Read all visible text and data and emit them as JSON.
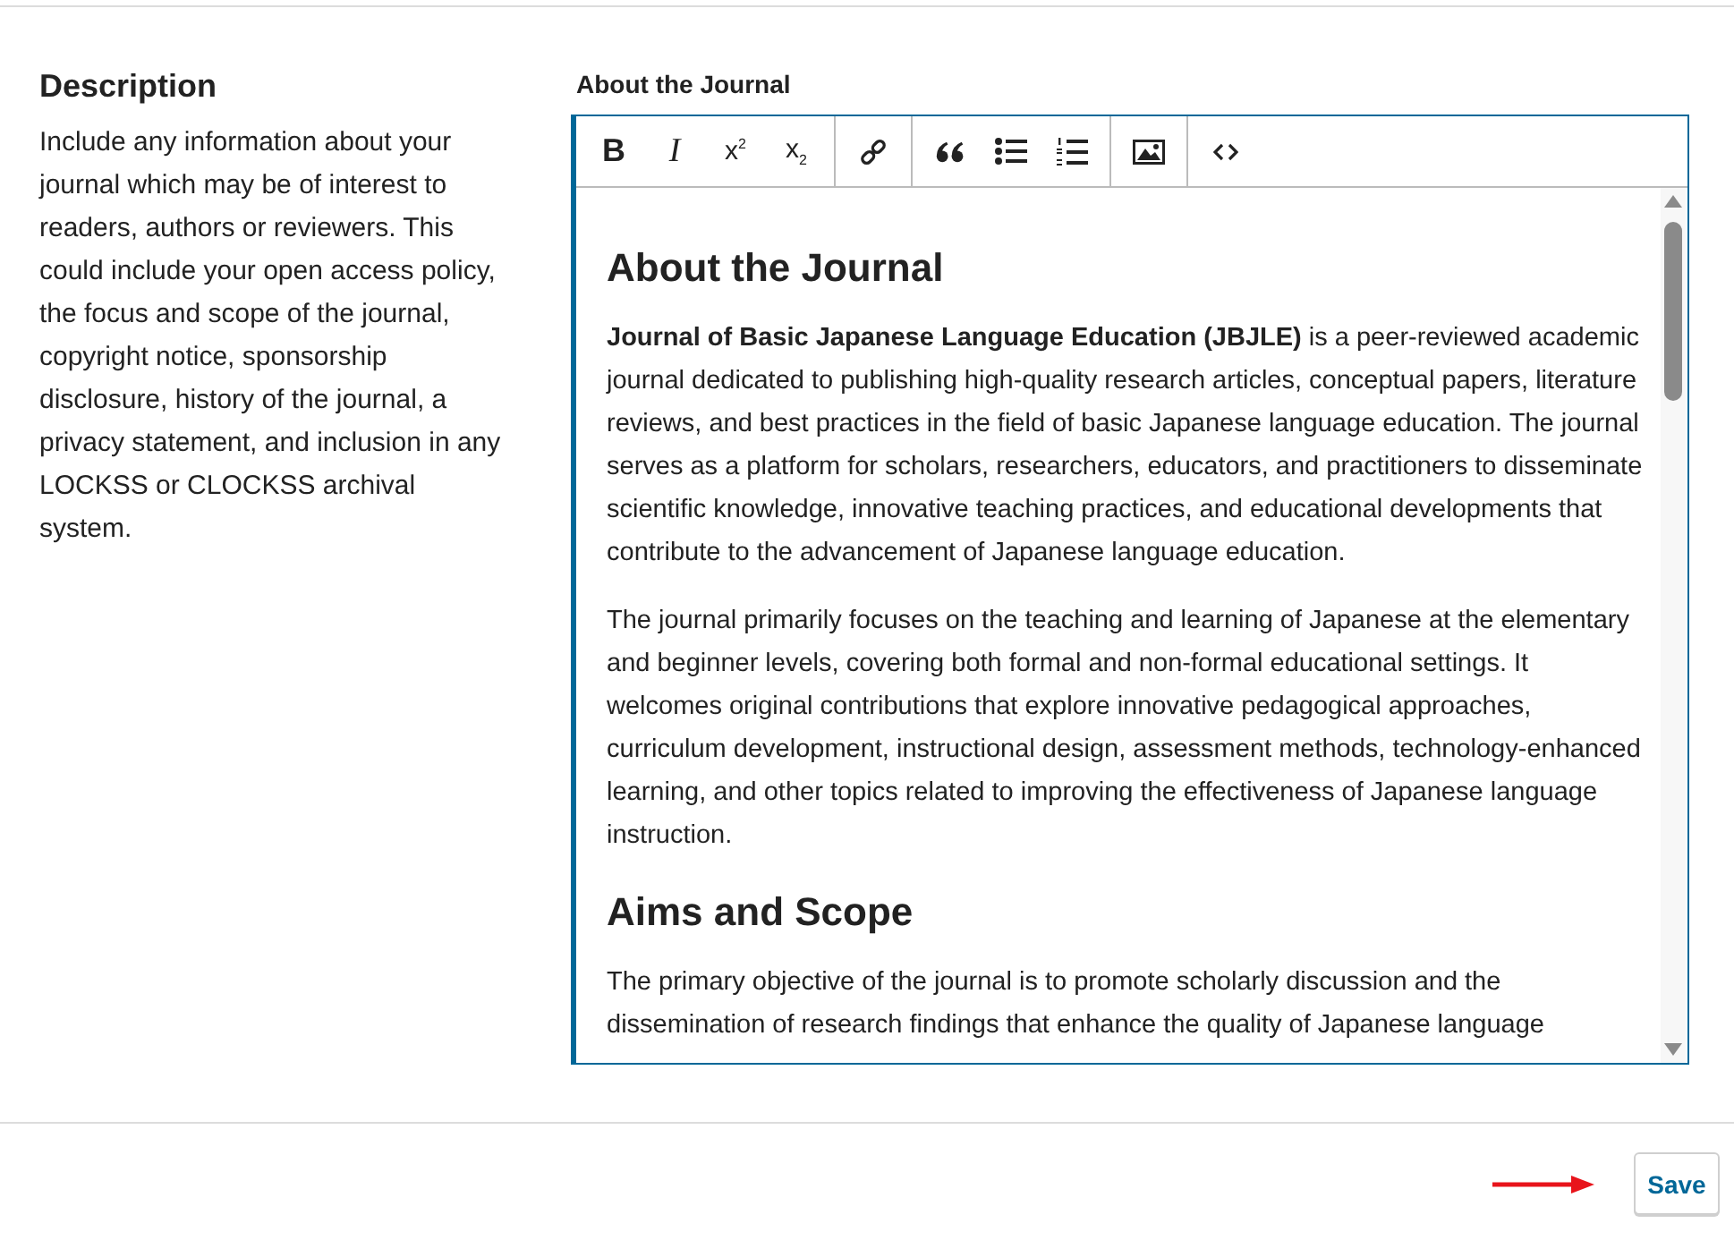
{
  "description": {
    "title": "Description",
    "text": "Include any information about your journal which may be of interest to readers, authors or reviewers. This could include your open access policy, the focus and scope of the journal, copyright notice, sponsorship disclosure, history of the journal, a privacy statement, and inclusion in any LOCKSS or CLOCKSS archival system."
  },
  "editor": {
    "label": "About the Journal",
    "toolbar": [
      {
        "buttons": [
          {
            "kind": "bold",
            "label": "B"
          },
          {
            "kind": "italic",
            "label": "I"
          },
          {
            "kind": "superscript",
            "label": "x$^{2}$"
          },
          {
            "kind": "subscript",
            "label": "x$_{2}$"
          }
        ]
      },
      {
        "buttons": [
          {
            "kind": "link"
          }
        ]
      },
      {
        "buttons": [
          {
            "kind": "blockquote"
          },
          {
            "kind": "bullets"
          },
          {
            "kind": "numbering"
          }
        ]
      },
      {
        "buttons": [
          {
            "kind": "image"
          }
        ]
      },
      {
        "buttons": [
          {
            "kind": "code"
          }
        ]
      }
    ],
    "content": [
      {
        "kind": "heading",
        "text": "About the Journal"
      },
      {
        "kind": "paragraph",
        "text": "**Journal of Basic Japanese Language Education (JBJLE)** is a peer-reviewed academic journal dedicated to publishing high-quality research articles, conceptual papers, literature reviews, and best practices in the field of basic Japanese language education. The journal serves as a platform for scholars, researchers, educators, and practitioners to disseminate scientific knowledge, innovative teaching practices, and educational developments that contribute to the advancement of Japanese language education."
      },
      {
        "kind": "paragraph",
        "text": "The journal primarily focuses on the teaching and learning of Japanese at the elementary and beginner levels, covering both formal and non-formal educational settings. It welcomes original contributions that explore innovative pedagogical approaches, curriculum development, instructional design, assessment methods, technology-enhanced learning, and other topics related to improving the effectiveness of Japanese language instruction."
      },
      {
        "kind": "heading",
        "text": "Aims and Scope"
      },
      {
        "kind": "paragraph",
        "text": "The primary objective of the journal is to promote scholarly discussion and the dissemination of research findings that enhance the quality of Japanese language"
      }
    ]
  },
  "save_button": "Save"
}
